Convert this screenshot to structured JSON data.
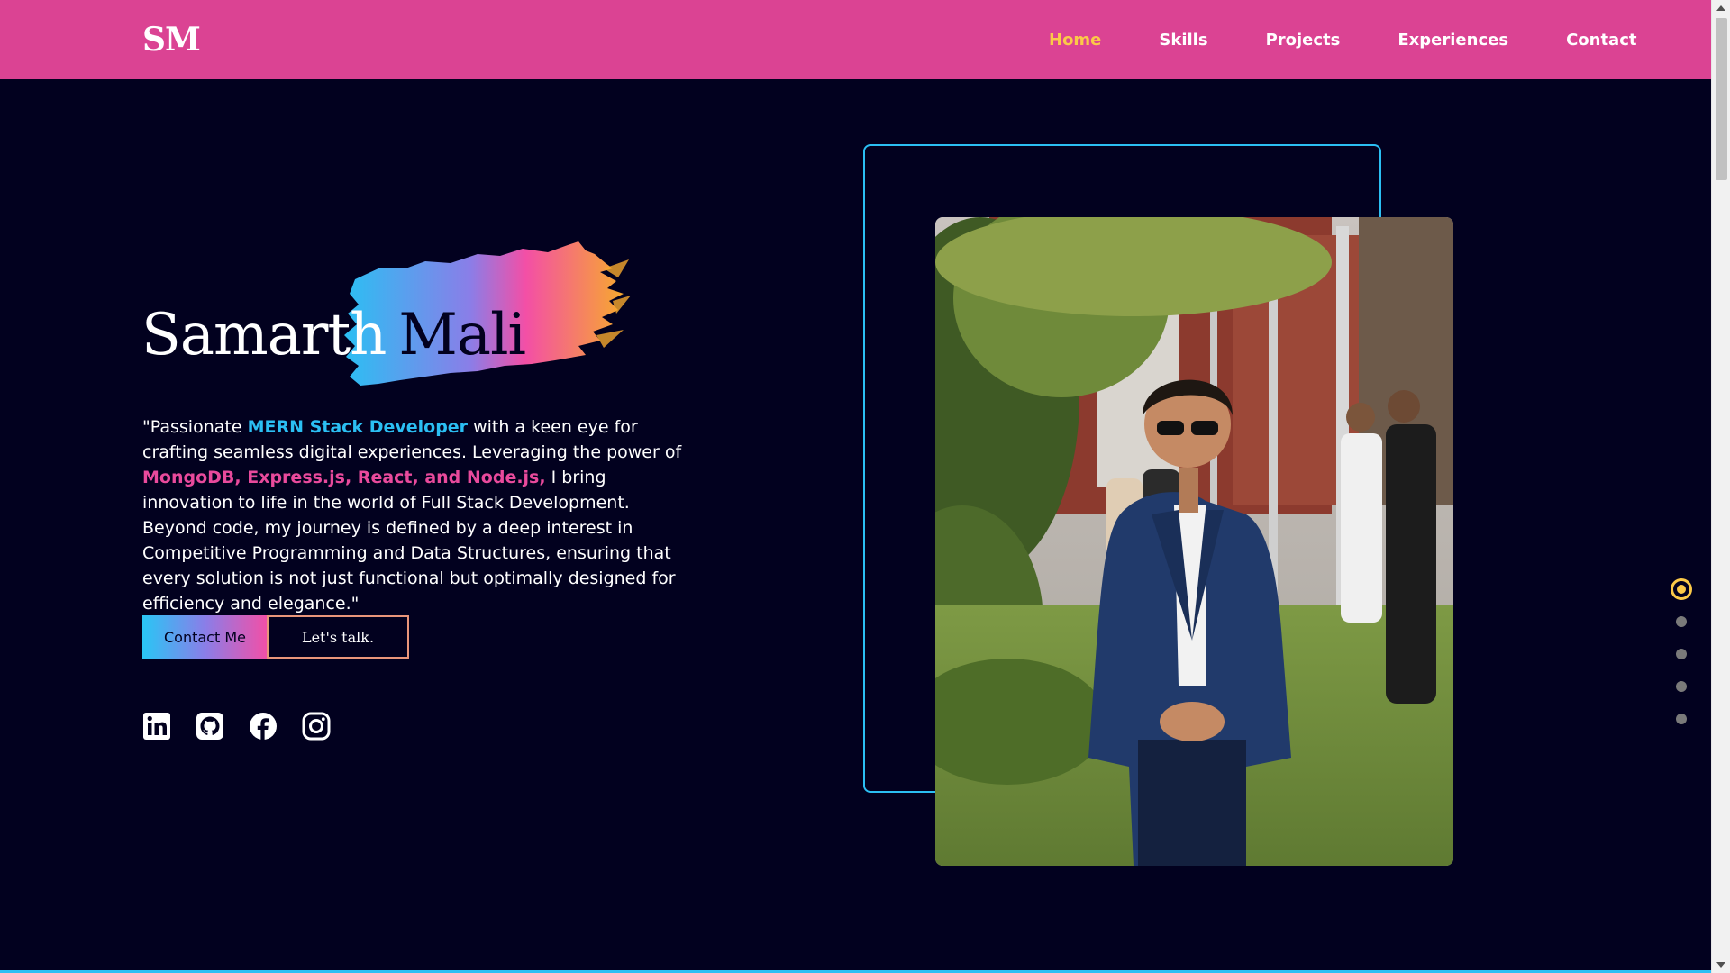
{
  "nav": {
    "logo": "SM",
    "links": [
      {
        "label": "Home",
        "active": true
      },
      {
        "label": "Skills",
        "active": false
      },
      {
        "label": "Projects",
        "active": false
      },
      {
        "label": "Experiences",
        "active": false
      },
      {
        "label": "Contact",
        "active": false
      }
    ]
  },
  "hero": {
    "first_name": "Samarth",
    "last_name": "Mali",
    "desc": {
      "p1": "\"Passionate ",
      "h1": "MERN Stack Developer",
      "p2": " with a keen eye for crafting seamless digital experiences. Leveraging the power of ",
      "h2": "MongoDB, Express.js, React, and Node.js,",
      "p3": " I bring innovation to life in the world of Full Stack Development. Beyond code, my journey is defined by a deep interest in Competitive Programming and Data Structures, ensuring that every solution is not just functional but optimally designed for efficiency and elegance.\""
    },
    "buttons": {
      "contact": "Contact Me",
      "talk": "Let's talk."
    },
    "socials": [
      "linkedin-icon",
      "github-icon",
      "facebook-icon",
      "instagram-icon"
    ]
  },
  "section_dots": {
    "count": 5,
    "active_index": 0
  },
  "colors": {
    "navbar": "#db4393",
    "background": "#02011f",
    "accent_yellow": "#fbc948",
    "accent_blue": "#2bbff3",
    "accent_pink": "#e94a9c"
  }
}
